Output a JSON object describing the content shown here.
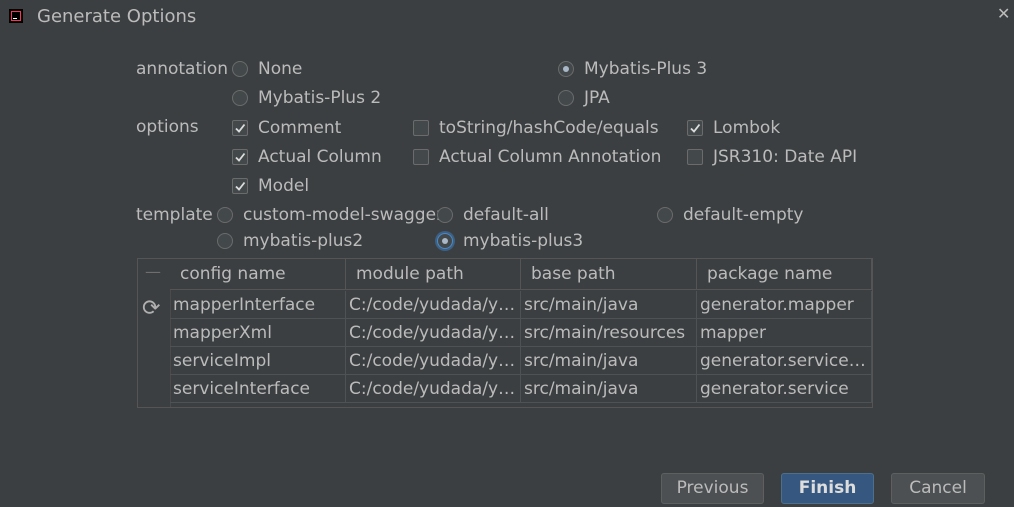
{
  "window": {
    "title": "Generate Options",
    "close_glyph": "✕"
  },
  "annotation": {
    "label": "annotation",
    "options": [
      {
        "label": "None",
        "selected": false
      },
      {
        "label": "Mybatis-Plus 3",
        "selected": true
      },
      {
        "label": "Mybatis-Plus 2",
        "selected": false
      },
      {
        "label": "JPA",
        "selected": false
      }
    ]
  },
  "options": {
    "label": "options",
    "items": [
      {
        "label": "Comment",
        "checked": true
      },
      {
        "label": "toString/hashCode/equals",
        "checked": false
      },
      {
        "label": "Lombok",
        "checked": true
      },
      {
        "label": "Actual Column",
        "checked": true
      },
      {
        "label": "Actual Column Annotation",
        "checked": false
      },
      {
        "label": "JSR310: Date API",
        "checked": false
      },
      {
        "label": "Model",
        "checked": true
      }
    ]
  },
  "template": {
    "label": "template",
    "options": [
      {
        "label": "custom-model-swagger",
        "selected": false
      },
      {
        "label": "default-all",
        "selected": false
      },
      {
        "label": "default-empty",
        "selected": false
      },
      {
        "label": "mybatis-plus2",
        "selected": false
      },
      {
        "label": "mybatis-plus3",
        "selected": true
      }
    ]
  },
  "table": {
    "toolbar": {
      "remove_glyph": "—",
      "refresh_glyph": "⟳"
    },
    "columns": [
      "config name",
      "module path",
      "base path",
      "package name"
    ],
    "rows": [
      [
        "mapperInterface",
        "C:/code/yudada/yu...",
        "src/main/java",
        "generator.mapper"
      ],
      [
        "mapperXml",
        "C:/code/yudada/yu...",
        "src/main/resources",
        "mapper"
      ],
      [
        "serviceImpl",
        "C:/code/yudada/yu...",
        "src/main/java",
        "generator.service.i..."
      ],
      [
        "serviceInterface",
        "C:/code/yudada/yu...",
        "src/main/java",
        "generator.service"
      ]
    ]
  },
  "buttons": {
    "previous": "Previous",
    "finish": "Finish",
    "cancel": "Cancel"
  }
}
